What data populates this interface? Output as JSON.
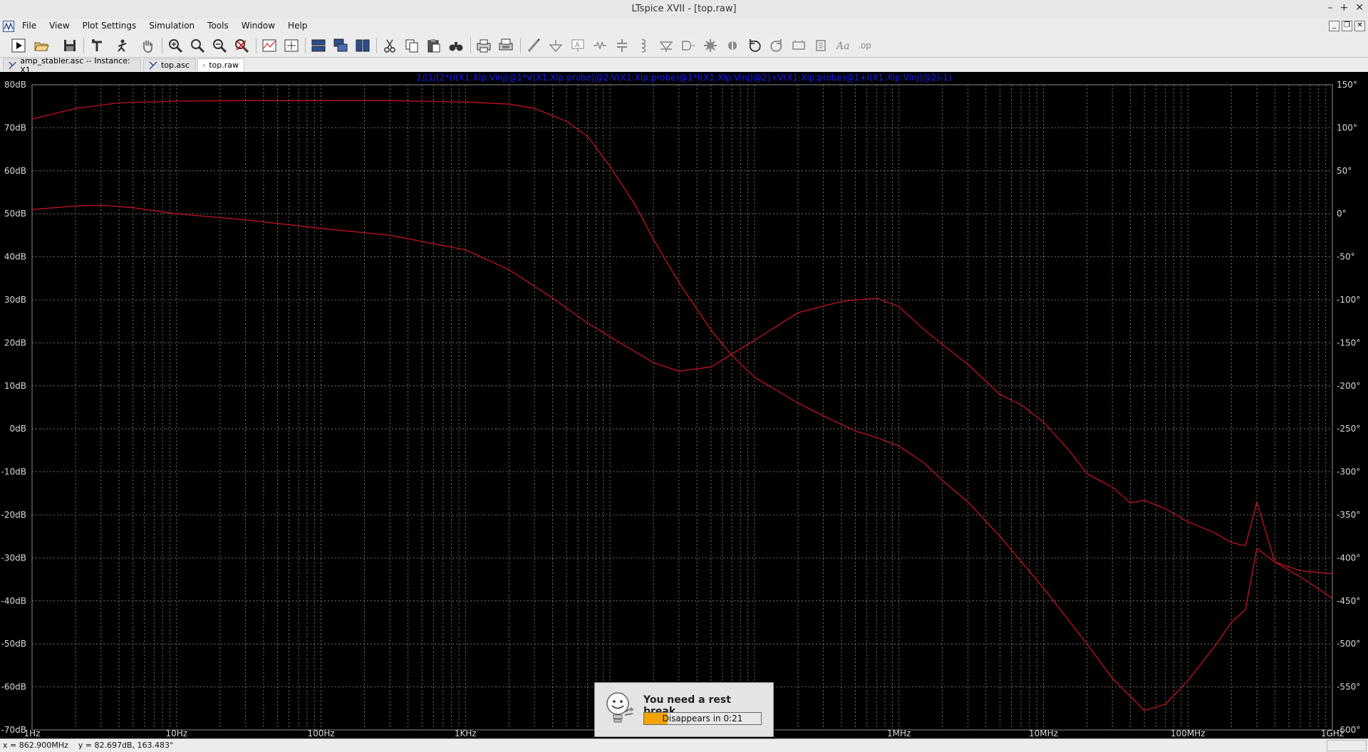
{
  "window": {
    "title": "LTspice XVII - [top.raw]"
  },
  "menu": [
    "File",
    "View",
    "Plot Settings",
    "Simulation",
    "Tools",
    "Window",
    "Help"
  ],
  "toolbar": {
    "icons": [
      "run-icon",
      "open-icon",
      "save-icon",
      "control-panel-icon",
      "halt-icon",
      "pan-hand-icon",
      "zoom-in-icon",
      "zoom-area-icon",
      "zoom-out-icon",
      "zoom-cancel-icon",
      "autorange-icon",
      "fit-icon",
      "tile-horizontal-icon",
      "cascade-icon",
      "tile-vertical-icon",
      "cut-icon",
      "copy-icon",
      "paste-icon",
      "find-icon",
      "print-icon",
      "print-preview-icon",
      "wire-icon",
      "ground-icon",
      "label-icon",
      "resistor-icon",
      "capacitor-icon",
      "inductor-icon",
      "diode-icon",
      "component-icon",
      "rotate-icon",
      "mirror-icon",
      "undo-icon",
      "redo-icon",
      "move-icon",
      "drag-icon",
      "text-icon",
      "spice-directive-icon"
    ]
  },
  "tabs": [
    {
      "label": "amp_stabler.asc -- Instance: X1",
      "icon": "schematic-icon",
      "active": false
    },
    {
      "label": "top.asc",
      "icon": "schematic-icon",
      "active": false
    },
    {
      "label": "top.raw",
      "icon": "waveform-icon",
      "active": true
    }
  ],
  "colors": {
    "trace": "#c1121f",
    "expression": "#1a1aff",
    "grid": "#8a8a8a",
    "background": "#000000",
    "axis_text": "#d8d8d8"
  },
  "chart_data": {
    "type": "line",
    "title": "1/(1/(2*(I(X1:Xlp:Vinj)@1*V(X1:Xlp:probe)@2-V(X1:Xlp:probe)@1*I(X1:Xlp:Vinj)@2)+V(X1:Xlp:probe)@1+I(X1:Xlp:Vinj)@2)-1)",
    "x_scale": "log",
    "xlim": [
      1,
      1000000000
    ],
    "x_ticks": [
      "1Hz",
      "10Hz",
      "100Hz",
      "1KHz",
      "10KHz",
      "100KHz",
      "1MHz",
      "10MHz",
      "100MHz",
      "1GHz"
    ],
    "ylim": [
      -70,
      80
    ],
    "y_ticks": [
      "80dB",
      "70dB",
      "60dB",
      "50dB",
      "40dB",
      "30dB",
      "20dB",
      "10dB",
      "0dB",
      "-10dB",
      "-20dB",
      "-30dB",
      "-40dB",
      "-50dB",
      "-60dB",
      "-70dB"
    ],
    "y2lim": [
      -600,
      150
    ],
    "y2_ticks": [
      "150°",
      "100°",
      "50°",
      "0°",
      "-50°",
      "-100°",
      "-150°",
      "-200°",
      "-250°",
      "-300°",
      "-350°",
      "-400°",
      "-450°",
      "-500°",
      "-550°",
      "-600°"
    ],
    "grid": true,
    "series": [
      {
        "axis": "left",
        "x": [
          1,
          2,
          4,
          10,
          30,
          100,
          300,
          1000,
          2000,
          3000,
          5000,
          7000,
          10000,
          15000,
          20000,
          30000,
          50000,
          70000,
          100000,
          200000,
          300000,
          500000,
          700000,
          1000000,
          1500000,
          2000000,
          3000000,
          5000000,
          10000000,
          20000000,
          30000000,
          50000000,
          70000000,
          100000000,
          150000000,
          200000000,
          250000000,
          300000000,
          400000000,
          600000000,
          1000000000
        ],
        "y": [
          72,
          74.5,
          75.8,
          76.2,
          76.3,
          76.3,
          76.3,
          76,
          75.5,
          74.5,
          71.5,
          68,
          61,
          52,
          44,
          34,
          23,
          17,
          12,
          6,
          3,
          -0.5,
          -2,
          -4,
          -8,
          -12,
          -17,
          -25,
          -37,
          -50,
          -58,
          -65.5,
          -64,
          -58.5,
          -51,
          -45,
          -42,
          -27.8,
          -31,
          -33,
          -33.7
        ]
      },
      {
        "axis": "right",
        "x": [
          1,
          2,
          3,
          5,
          10,
          30,
          100,
          300,
          1000,
          2000,
          4000,
          7000,
          10000,
          20000,
          30000,
          50000,
          100000,
          200000,
          400000,
          700000,
          1000000,
          1500000,
          2000000,
          3000000,
          5000000,
          7000000,
          10000000,
          15000000,
          20000000,
          30000000,
          40000000,
          50000000,
          70000000,
          100000000,
          150000000,
          200000000,
          250000000,
          300000000,
          400000000,
          600000000,
          1000000000
        ],
        "y": [
          5,
          9,
          10,
          7,
          0,
          -7,
          -17,
          -25,
          -42,
          -65,
          -98,
          -127,
          -143,
          -173,
          -183,
          -178,
          -147,
          -115,
          -102,
          -98,
          -108,
          -135,
          -152,
          -175,
          -210,
          -222,
          -242,
          -275,
          -302,
          -318,
          -336,
          -333,
          -343,
          -358,
          -370,
          -382,
          -386,
          -335,
          -405,
          -422,
          -447
        ]
      }
    ]
  },
  "status": {
    "readout": "x = 862.900MHz    y = 82.697dB, 163.483°"
  },
  "popup": {
    "message": "You need a rest break...",
    "countdown": "Disappears in 0:21",
    "progress": 0.2
  }
}
